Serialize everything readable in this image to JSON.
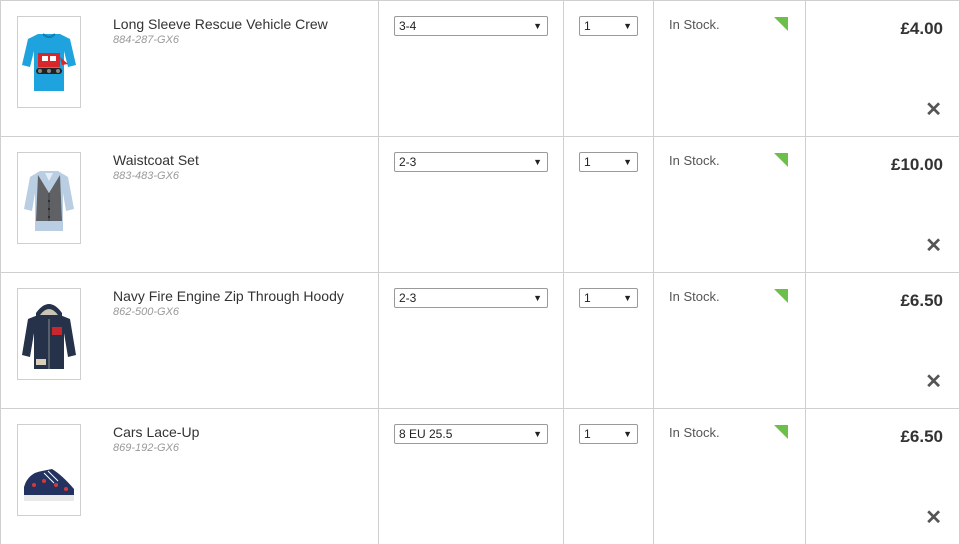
{
  "basket": {
    "items": [
      {
        "name": "Long Sleeve Rescue Vehicle Crew",
        "code": "884-287-GX6",
        "size": "3-4",
        "quantity": "1",
        "stock": "In Stock.",
        "price": "£4.00",
        "remove_icon": "close-icon",
        "image": "blue-long-sleeve-top"
      },
      {
        "name": "Waistcoat Set",
        "code": "883-483-GX6",
        "size": "2-3",
        "quantity": "1",
        "stock": "In Stock.",
        "price": "£10.00",
        "remove_icon": "close-icon",
        "image": "grey-waistcoat-set"
      },
      {
        "name": "Navy Fire Engine Zip Through Hoody",
        "code": "862-500-GX6",
        "size": "2-3",
        "quantity": "1",
        "stock": "In Stock.",
        "price": "£6.50",
        "remove_icon": "close-icon",
        "image": "navy-hoody"
      },
      {
        "name": "Cars Lace-Up",
        "code": "869-192-GX6",
        "size": "8 EU 25.5",
        "quantity": "1",
        "stock": "In Stock.",
        "price": "£6.50",
        "remove_icon": "close-icon",
        "image": "navy-lace-up-shoe"
      }
    ]
  },
  "colors": {
    "stock_indicator": "#6cc04a",
    "border": "#cfcfcf",
    "text": "#333333",
    "muted": "#999999"
  }
}
